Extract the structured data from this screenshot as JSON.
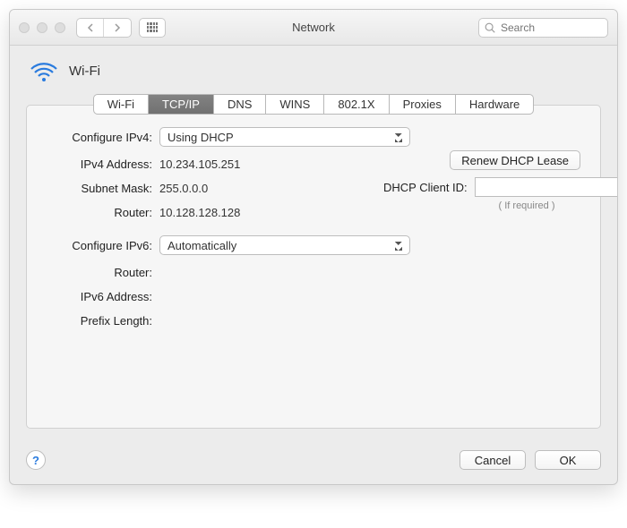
{
  "window": {
    "title": "Network",
    "search_placeholder": "Search"
  },
  "header": {
    "iface": "Wi-Fi"
  },
  "tabs": [
    "Wi-Fi",
    "TCP/IP",
    "DNS",
    "WINS",
    "802.1X",
    "Proxies",
    "Hardware"
  ],
  "active_tab": "TCP/IP",
  "labels": {
    "configure_ipv4": "Configure IPv4:",
    "ipv4_address": "IPv4 Address:",
    "subnet_mask": "Subnet Mask:",
    "router": "Router:",
    "configure_ipv6": "Configure IPv6:",
    "router6": "Router:",
    "ipv6_address": "IPv6 Address:",
    "prefix_length": "Prefix Length:",
    "dhcp_client_id": "DHCP Client ID:",
    "if_required": "( If required )"
  },
  "values": {
    "configure_ipv4": "Using DHCP",
    "ipv4_address": "10.234.105.251",
    "subnet_mask": "255.0.0.0",
    "router": "10.128.128.128",
    "configure_ipv6": "Automatically",
    "router6": "",
    "ipv6_address": "",
    "prefix_length": "",
    "dhcp_client_id": ""
  },
  "buttons": {
    "renew": "Renew DHCP Lease",
    "cancel": "Cancel",
    "ok": "OK"
  }
}
